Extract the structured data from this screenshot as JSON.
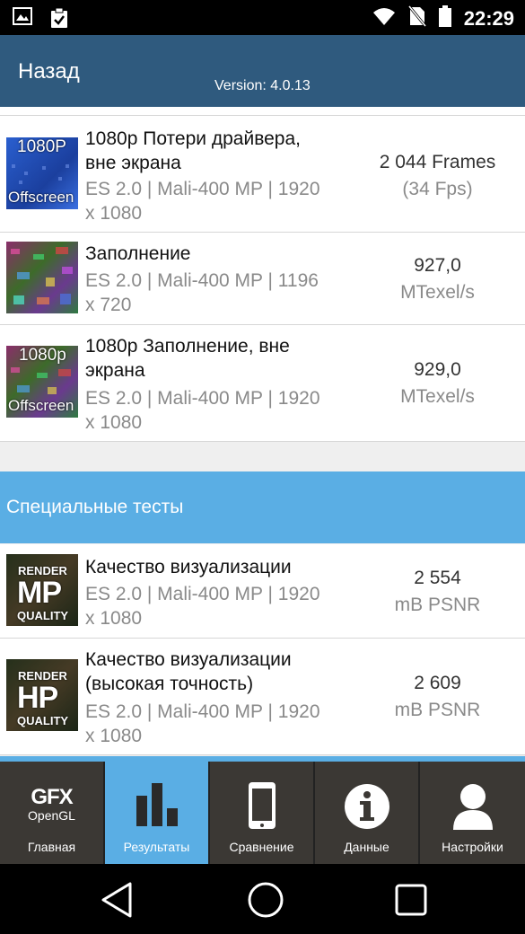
{
  "status_bar": {
    "time": "22:29"
  },
  "header": {
    "back_label": "Назад",
    "version": "Version: 4.0.13"
  },
  "tests": [
    {
      "thumb_top": "1080P",
      "thumb_bottom": "Offscreen",
      "title_line1": "1080p Потери драйвера,",
      "title_line2": "вне экрана",
      "sub_line1": "ES 2.0 | Mali-400 MP | 1920",
      "sub_line2": "x 1080",
      "score_value": "2 044 Frames",
      "score_unit": "(34 Fps)"
    },
    {
      "title_line1": "Заполнение",
      "sub_line1": "ES 2.0 | Mali-400 MP | 1196",
      "sub_line2": "x 720",
      "score_value": "927,0",
      "score_unit": "MTexel/s"
    },
    {
      "thumb_top": "1080p",
      "thumb_bottom": "Offscreen",
      "title_line1": "1080p Заполнение, вне",
      "title_line2": "экрана",
      "sub_line1": "ES 2.0 | Mali-400 MP | 1920",
      "sub_line2": "x 1080",
      "score_value": "929,0",
      "score_unit": "MTexel/s"
    }
  ],
  "special_section": {
    "title": "Специальные тесты"
  },
  "special_tests": [
    {
      "thumb_top": "RENDER",
      "thumb_mid": "MP",
      "thumb_bottom": "QUALITY",
      "title_line1": "Качество визуализации",
      "sub_line1": "ES 2.0 | Mali-400 MP | 1920",
      "sub_line2": "x 1080",
      "score_value": "2 554",
      "score_unit": "mB PSNR"
    },
    {
      "thumb_top": "RENDER",
      "thumb_mid": "HP",
      "thumb_bottom": "QUALITY",
      "title_line1": "Качество визуализации",
      "title_line2": "(высокая точность)",
      "sub_line1": "ES 2.0 | Mali-400 MP | 1920",
      "sub_line2": "x 1080",
      "score_value": "2 609",
      "score_unit": "mB PSNR"
    }
  ],
  "tabs": [
    {
      "label": "Главная",
      "icon_top": "GFX",
      "icon_bottom": "OpenGL"
    },
    {
      "label": "Результаты",
      "active": true
    },
    {
      "label": "Сравнение"
    },
    {
      "label": "Данные"
    },
    {
      "label": "Настройки"
    }
  ],
  "colors": {
    "header": "#2f5a7e",
    "accent": "#5aaee4",
    "tab_bg": "#3b3834"
  }
}
